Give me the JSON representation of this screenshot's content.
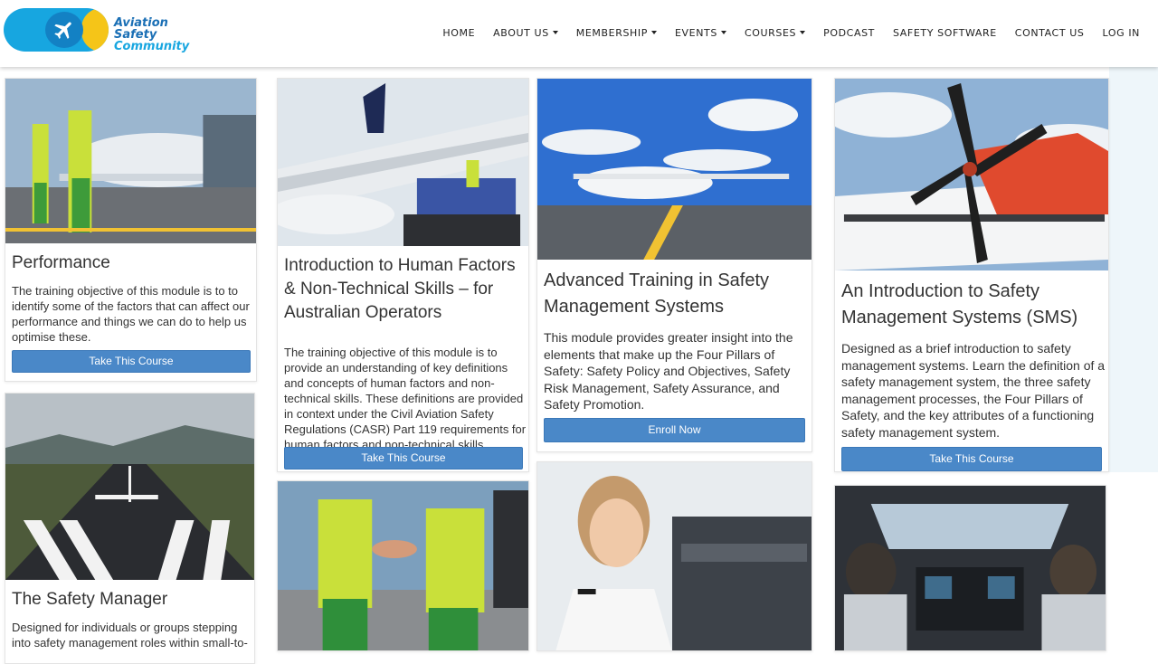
{
  "brand": {
    "line1": "Aviation",
    "line2": "Safety",
    "line3": "Community",
    "colors": {
      "primary_blue": "#17a6e0",
      "dark_blue": "#1381c4",
      "yellow": "#f5c518",
      "button_blue": "#4a88c8"
    }
  },
  "nav": {
    "items": [
      {
        "label": "HOME"
      },
      {
        "label": "ABOUT US"
      },
      {
        "label": "MEMBERSHIP"
      },
      {
        "label": "EVENTS"
      },
      {
        "label": "COURSES"
      },
      {
        "label": "PODCAST"
      },
      {
        "label": "SAFETY SOFTWARE"
      },
      {
        "label": "CONTACT US"
      },
      {
        "label": "LOG IN"
      }
    ]
  },
  "courses": [
    {
      "title": "Performance",
      "description": "The training objective of this module is to to identify some of the factors that can affect our performance and things we can do to help us optimise these.",
      "button": "Take This Course",
      "image": "ground-crew-airliner-photo"
    },
    {
      "title": "Introduction to Human Factors & Non-Technical Skills – for Australian Operators",
      "description": "The training objective of this module is to provide an understanding of key definitions and concepts of human factors and non-technical skills. These definitions are provided in context under the Civil Aviation Safety Regulations (CASR) Part 119 requirements for human factors and non-technical skills training.",
      "button": "Take This Course",
      "image": "wing-maintenance-lift-photo"
    },
    {
      "title": "Advanced Training in Safety Management Systems",
      "description": "This module provides greater insight into the elements that make up the Four Pillars of Safety: Safety Policy and Objectives, Safety Risk Management, Safety Assurance, and Safety Promotion.",
      "button": "Enroll Now",
      "image": "turboprop-boarding-photo"
    },
    {
      "title": "An Introduction to Safety Management Systems (SMS)",
      "description": "Designed as a brief introduction to safety management systems. Learn the definition of a safety management system, the three safety management processes, the Four Pillars of Safety, and the key attributes of a functioning safety management system.",
      "button": "Take This Course",
      "image": "propeller-closeup-photo"
    },
    {
      "title": "The Safety Manager",
      "description": "Designed for individuals or groups stepping into safety management roles within small-to-",
      "image": "runway-photo"
    },
    {
      "image": "handshake-photo"
    },
    {
      "image": "pilot-portrait-photo"
    },
    {
      "image": "cockpit-pilots-photo"
    }
  ]
}
